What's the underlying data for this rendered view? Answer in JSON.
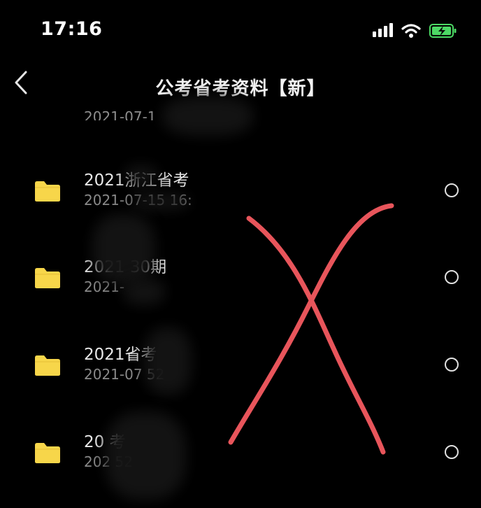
{
  "status_bar": {
    "time": "17:16",
    "icons": [
      "signal-icon",
      "wifi-icon",
      "battery-charging-icon"
    ],
    "battery_color": "#4cd964"
  },
  "nav": {
    "back_icon": "chevron-left-icon",
    "title": "公考省考资料【新】"
  },
  "partial_row": {
    "date": "2021-07-1"
  },
  "files": [
    {
      "name": "2021浙江省考",
      "date": "2021-07-15 16:",
      "icon": "folder-icon",
      "selected": false
    },
    {
      "name": "2021 30期",
      "date": "2021-",
      "icon": "folder-icon",
      "selected": false
    },
    {
      "name": "2021省考",
      "date": "2021-07 52",
      "icon": "folder-icon",
      "selected": false
    },
    {
      "name": "20 考",
      "date": "202 52",
      "icon": "folder-icon",
      "selected": false
    }
  ],
  "colors": {
    "background": "#000000",
    "folder": "#f7d64a",
    "overlay_mark": "#e8555b"
  },
  "overlay": {
    "mark": "red-x-annotation"
  }
}
